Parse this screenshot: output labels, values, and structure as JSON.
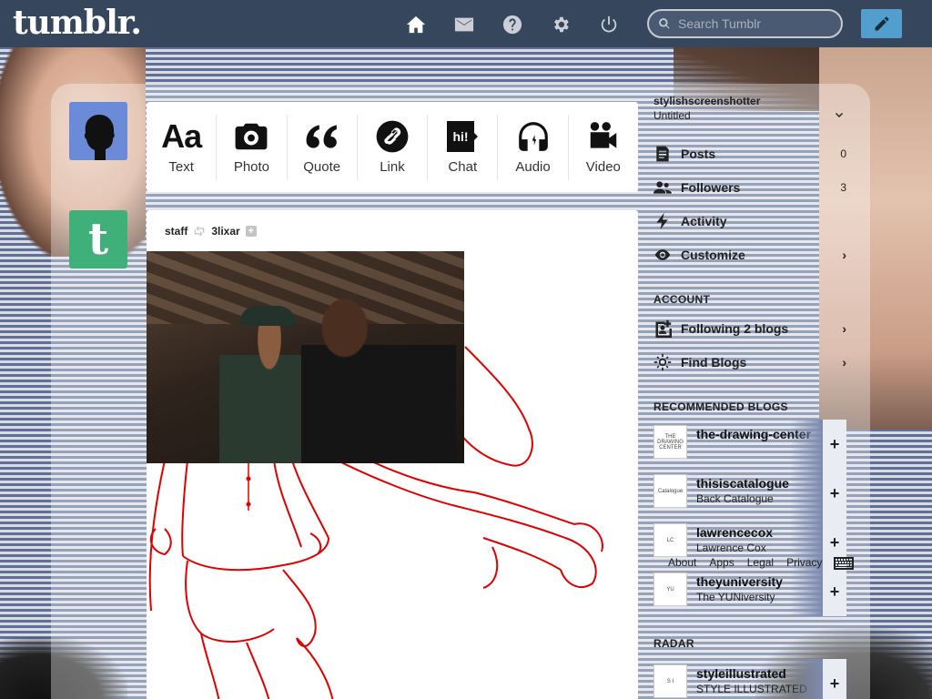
{
  "header": {
    "logo": "tumblr.",
    "search_placeholder": "Search Tumblr",
    "nav_icons": [
      "home-icon",
      "mail-icon",
      "help-icon",
      "gear-icon",
      "power-icon"
    ],
    "compose_icon": "pencil-icon",
    "bar_color": "#36465d",
    "accent_color": "#529ecc"
  },
  "post_types": [
    {
      "label": "Text",
      "icon": "text-icon",
      "glyph": "Aa"
    },
    {
      "label": "Photo",
      "icon": "camera-icon"
    },
    {
      "label": "Quote",
      "icon": "quote-icon"
    },
    {
      "label": "Link",
      "icon": "link-icon"
    },
    {
      "label": "Chat",
      "icon": "chat-icon",
      "glyph": "hi!"
    },
    {
      "label": "Audio",
      "icon": "headphones-icon"
    },
    {
      "label": "Video",
      "icon": "video-camera-icon"
    }
  ],
  "post": {
    "author": "staff",
    "reblogged_from": "3lixar"
  },
  "sidebar": {
    "blog_name": "stylishscreenshotter",
    "blog_title": "Untitled",
    "items": [
      {
        "label": "Posts",
        "count": "0",
        "icon": "posts-icon"
      },
      {
        "label": "Followers",
        "count": "3",
        "icon": "followers-icon"
      },
      {
        "label": "Activity",
        "icon": "lightning-icon"
      },
      {
        "label": "Customize",
        "icon": "eye-icon",
        "arrow": "›"
      }
    ],
    "account_heading": "ACCOUNT",
    "account_items": [
      {
        "label": "Following 2 blogs",
        "icon": "following-icon",
        "arrow": "›"
      },
      {
        "label": "Find Blogs",
        "icon": "compass-icon",
        "arrow": "›"
      }
    ],
    "recommended_heading": "RECOMMENDED BLOGS",
    "recommended": [
      {
        "name": "the-drawing-center",
        "title": "",
        "thumb_text": "THE DRAWING CENTER"
      },
      {
        "name": "thisiscatalogue",
        "title": "Back Catalogue",
        "thumb_text": "Catalogue"
      },
      {
        "name": "lawrencecox",
        "title": "Lawrence Cox",
        "thumb_text": "LC"
      },
      {
        "name": "theyuniversity",
        "title": "The YUNiversity",
        "thumb_text": "YU"
      }
    ],
    "footer_links": [
      "About",
      "Apps",
      "Legal",
      "Privacy"
    ],
    "radar_heading": "RADAR",
    "radar": {
      "name": "styleillustrated",
      "title": "STYLE ILLUSTRATED",
      "thumb_text": "S I"
    }
  }
}
